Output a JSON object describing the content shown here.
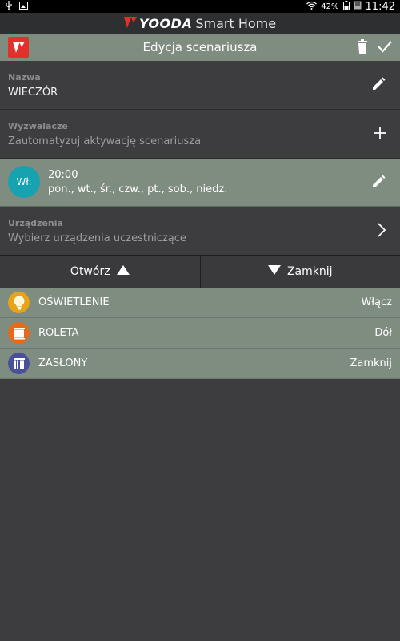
{
  "status_bar": {
    "battery": "42%",
    "time": "11:42"
  },
  "brand": {
    "name": "YOODA",
    "sub": "Smart Home"
  },
  "header": {
    "title": "Edycja scenariusza"
  },
  "name_section": {
    "label": "Nazwa",
    "value": "WIECZÓR"
  },
  "triggers_section": {
    "label": "Wyzwalacze",
    "hint": "Zautomatyzuj aktywację scenariusza"
  },
  "trigger": {
    "badge": "Wł.",
    "time": "20:00",
    "days": "pon., wt., śr., czw., pt., sob., niedz."
  },
  "devices_section": {
    "label": "Urządzenia",
    "hint": "Wybierz urządzenia uczestniczące"
  },
  "split": {
    "open_label": "Otwórz",
    "close_label": "Zamknij"
  },
  "devices": [
    {
      "name": "OŚWIETLENIE",
      "state": "Włącz",
      "icon": "bulb-icon",
      "color": "#e8a317"
    },
    {
      "name": "ROLETA",
      "state": "Dół",
      "icon": "roller-blind-icon",
      "color": "#e76a1c"
    },
    {
      "name": "ZASŁONY",
      "state": "Zamknij",
      "icon": "curtain-icon",
      "color": "#4a4f9a"
    }
  ],
  "colors": {
    "accent_bar": "#7f8c80",
    "background": "#3d3d40",
    "trigger_badge": "#17a2b0",
    "brand_red": "#e2302a"
  }
}
